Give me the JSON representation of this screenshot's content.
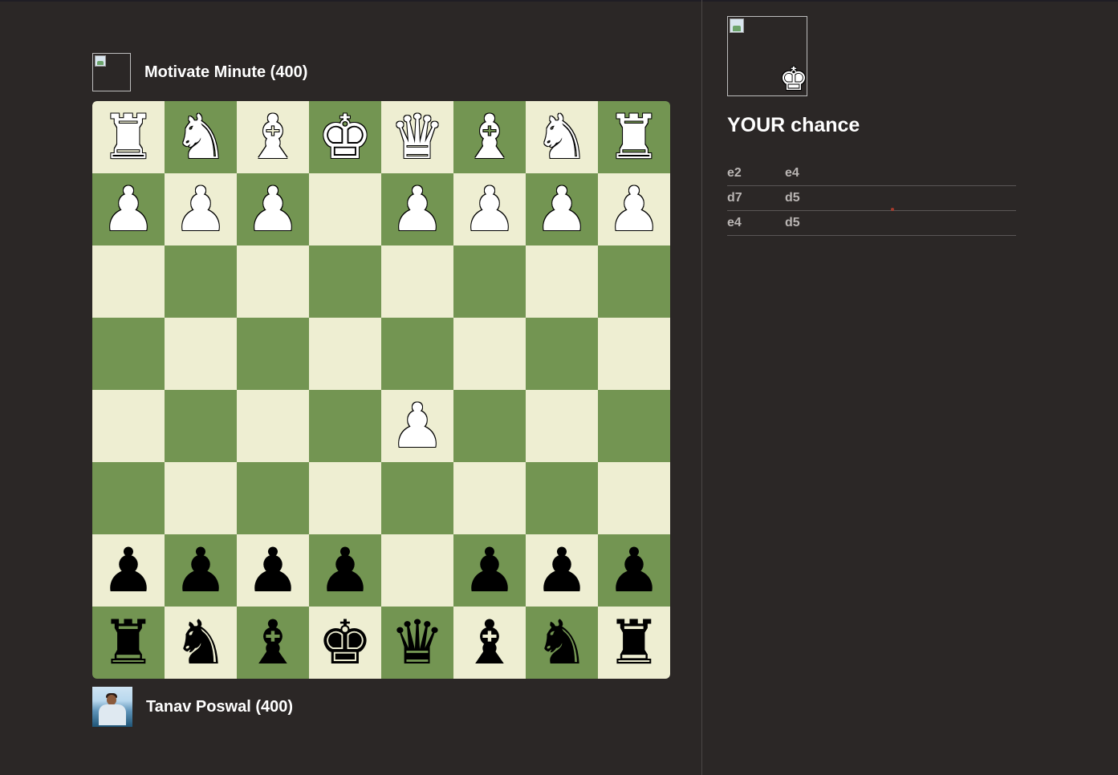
{
  "players": {
    "opponent": {
      "name": "Motivate Minute (400)"
    },
    "self": {
      "name": "Tanav Poswal (400)"
    }
  },
  "board": {
    "colors": {
      "light": "#eeeed2",
      "dark": "#739552"
    },
    "ranks": [
      [
        "wR",
        "wN",
        "wB",
        "wK",
        "wQ",
        "wB",
        "wN",
        "wR"
      ],
      [
        "wP",
        "wP",
        "wP",
        "",
        "wP",
        "wP",
        "wP",
        "wP"
      ],
      [
        "",
        "",
        "",
        "",
        "",
        "",
        "",
        ""
      ],
      [
        "",
        "",
        "",
        "",
        "",
        "",
        "",
        ""
      ],
      [
        "",
        "",
        "",
        "",
        "wP",
        "",
        "",
        ""
      ],
      [
        "",
        "",
        "",
        "",
        "",
        "",
        "",
        ""
      ],
      [
        "bP",
        "bP",
        "bP",
        "bP",
        "",
        "bP",
        "bP",
        "bP"
      ],
      [
        "bR",
        "bN",
        "bB",
        "bK",
        "bQ",
        "bB",
        "bN",
        "bR"
      ]
    ]
  },
  "sidebar": {
    "turn_text": "YOUR chance",
    "turn_icon": "white-king-icon",
    "moves": [
      {
        "from": "e2",
        "to": "e4"
      },
      {
        "from": "d7",
        "to": "d5"
      },
      {
        "from": "e4",
        "to": "d5"
      }
    ]
  }
}
